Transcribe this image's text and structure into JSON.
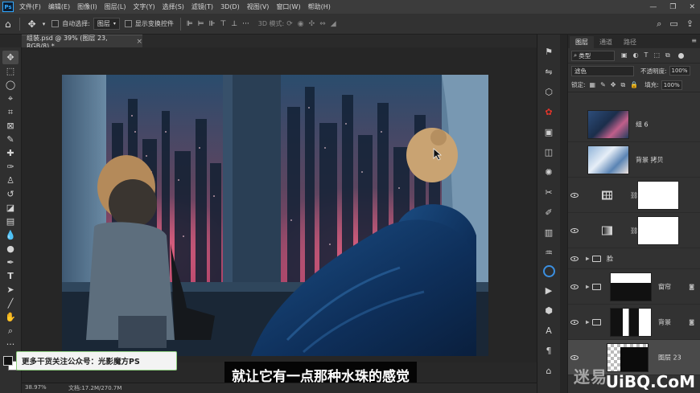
{
  "app": {
    "logo": "Ps",
    "menus": [
      "文件(F)",
      "编辑(E)",
      "图像(I)",
      "图层(L)",
      "文字(Y)",
      "选择(S)",
      "滤镜(T)",
      "3D(D)",
      "视图(V)",
      "窗口(W)",
      "帮助(H)"
    ],
    "window_controls": [
      "—",
      "❐",
      "✕"
    ]
  },
  "options": {
    "auto_select_label": "自动选择:",
    "auto_select_value": "图层",
    "show_transform_label": "显示变换控件",
    "mode_3d_label": "3D 模式:"
  },
  "document": {
    "tab_title": "组装.psd @ 39% (图层 23, RGB/8) *",
    "tab_close": "×"
  },
  "status": {
    "zoom": "38.97%",
    "doc_size": "文档:17.2M/270.7M"
  },
  "overlay": {
    "banner": "更多干货关注公众号：光影魔方PS",
    "subtitle": "就让它有一点那种水珠的感觉"
  },
  "panel": {
    "tabs": [
      "图层",
      "通道",
      "路径"
    ],
    "menu_icon": "≡",
    "filter_kind": "类型",
    "blend_mode": "滤色",
    "opacity_label": "不透明度:",
    "opacity_value": "100%",
    "lock_label": "锁定:",
    "fill_label": "填充:",
    "fill_value": "100%"
  },
  "layers": [
    {
      "name": "组 6",
      "visible": false,
      "type": "photo"
    },
    {
      "name": "背景 拷贝",
      "visible": false,
      "type": "photo-light"
    },
    {
      "name": "",
      "visible": true,
      "type": "grid-adjust"
    },
    {
      "name": "",
      "visible": true,
      "type": "gradient-adjust"
    },
    {
      "name": "脸",
      "visible": true,
      "type": "folder"
    },
    {
      "name": "窗帘",
      "visible": true,
      "type": "folder-mask"
    },
    {
      "name": "背景",
      "visible": true,
      "type": "folder-mask"
    },
    {
      "name": "图层 23",
      "visible": true,
      "type": "selected-layer"
    }
  ],
  "watermark": {
    "left_text": "迷易",
    "site_text": "UiBQ.CoM"
  },
  "colors": {
    "ps_blue": "#31a8ff",
    "cc_red": "#e0352b",
    "banner_border": "#8fcf7f"
  }
}
